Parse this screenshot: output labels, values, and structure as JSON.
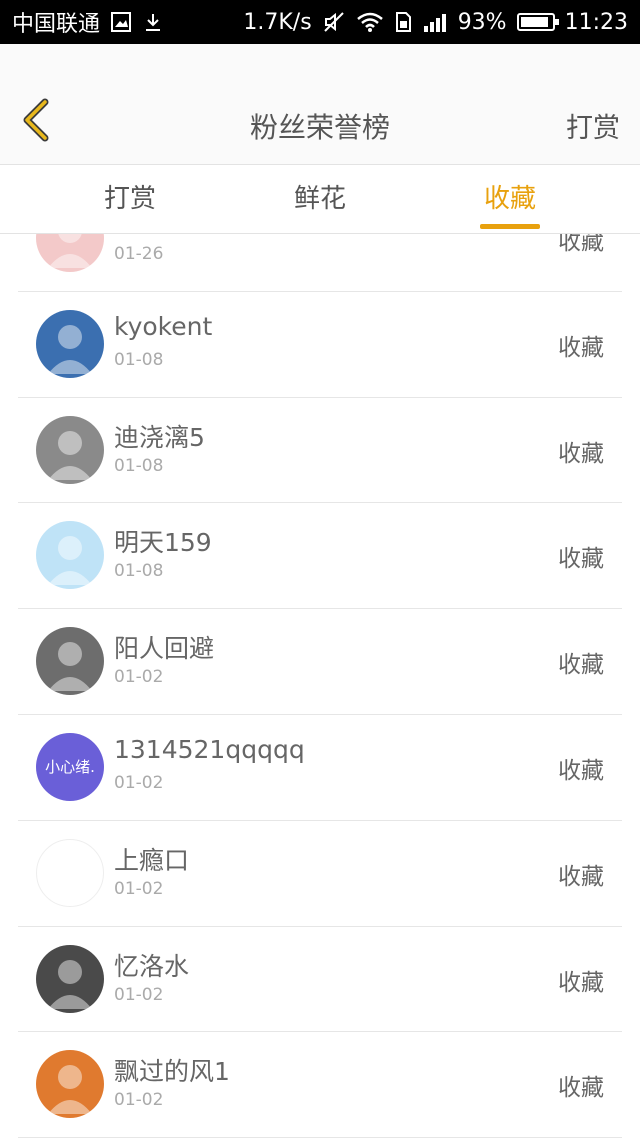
{
  "status_bar": {
    "carrier": "中国联通",
    "speed": "1.7K/s",
    "battery": "93%",
    "battery_level": 0.93,
    "time": "11:23",
    "icons": [
      "image-icon",
      "download-icon",
      "mute-icon",
      "wifi-icon",
      "sim-icon",
      "signal-icon",
      "battery-icon"
    ]
  },
  "header": {
    "title": "粉丝荣誉榜",
    "right_action": "打赏",
    "back_icon": "chevron-left-icon",
    "accent_color": "#e8a10e"
  },
  "tabs": [
    {
      "label": "打赏",
      "active": false
    },
    {
      "label": "鲜花",
      "active": false
    },
    {
      "label": "收藏",
      "active": true
    }
  ],
  "list": {
    "items": [
      {
        "name": "",
        "date": "01-26",
        "action": "收藏",
        "avatar_color": "#f3c9c9"
      },
      {
        "name": "kyokent",
        "date": "01-08",
        "action": "收藏",
        "avatar_color": "#3b6fb0"
      },
      {
        "name": "迪浇漓5",
        "date": "01-08",
        "action": "收藏",
        "avatar_color": "#8a8a8a"
      },
      {
        "name": "明天159",
        "date": "01-08",
        "action": "收藏",
        "avatar_color": "#bfe3f7"
      },
      {
        "name": "阳人回避",
        "date": "01-02",
        "action": "收藏",
        "avatar_color": "#6d6d6d"
      },
      {
        "name": "1314521qqqqq",
        "date": "01-02",
        "action": "收藏",
        "avatar_color": "#6a5fd8",
        "avatar_text": "小心绪."
      },
      {
        "name": "上瘾口",
        "date": "01-02",
        "action": "收藏",
        "avatar_color": "#ffffff"
      },
      {
        "name": "忆洛水",
        "date": "01-02",
        "action": "收藏",
        "avatar_color": "#4a4a4a"
      },
      {
        "name": "飘过的风1",
        "date": "01-02",
        "action": "收藏",
        "avatar_color": "#e07a2f"
      }
    ]
  }
}
